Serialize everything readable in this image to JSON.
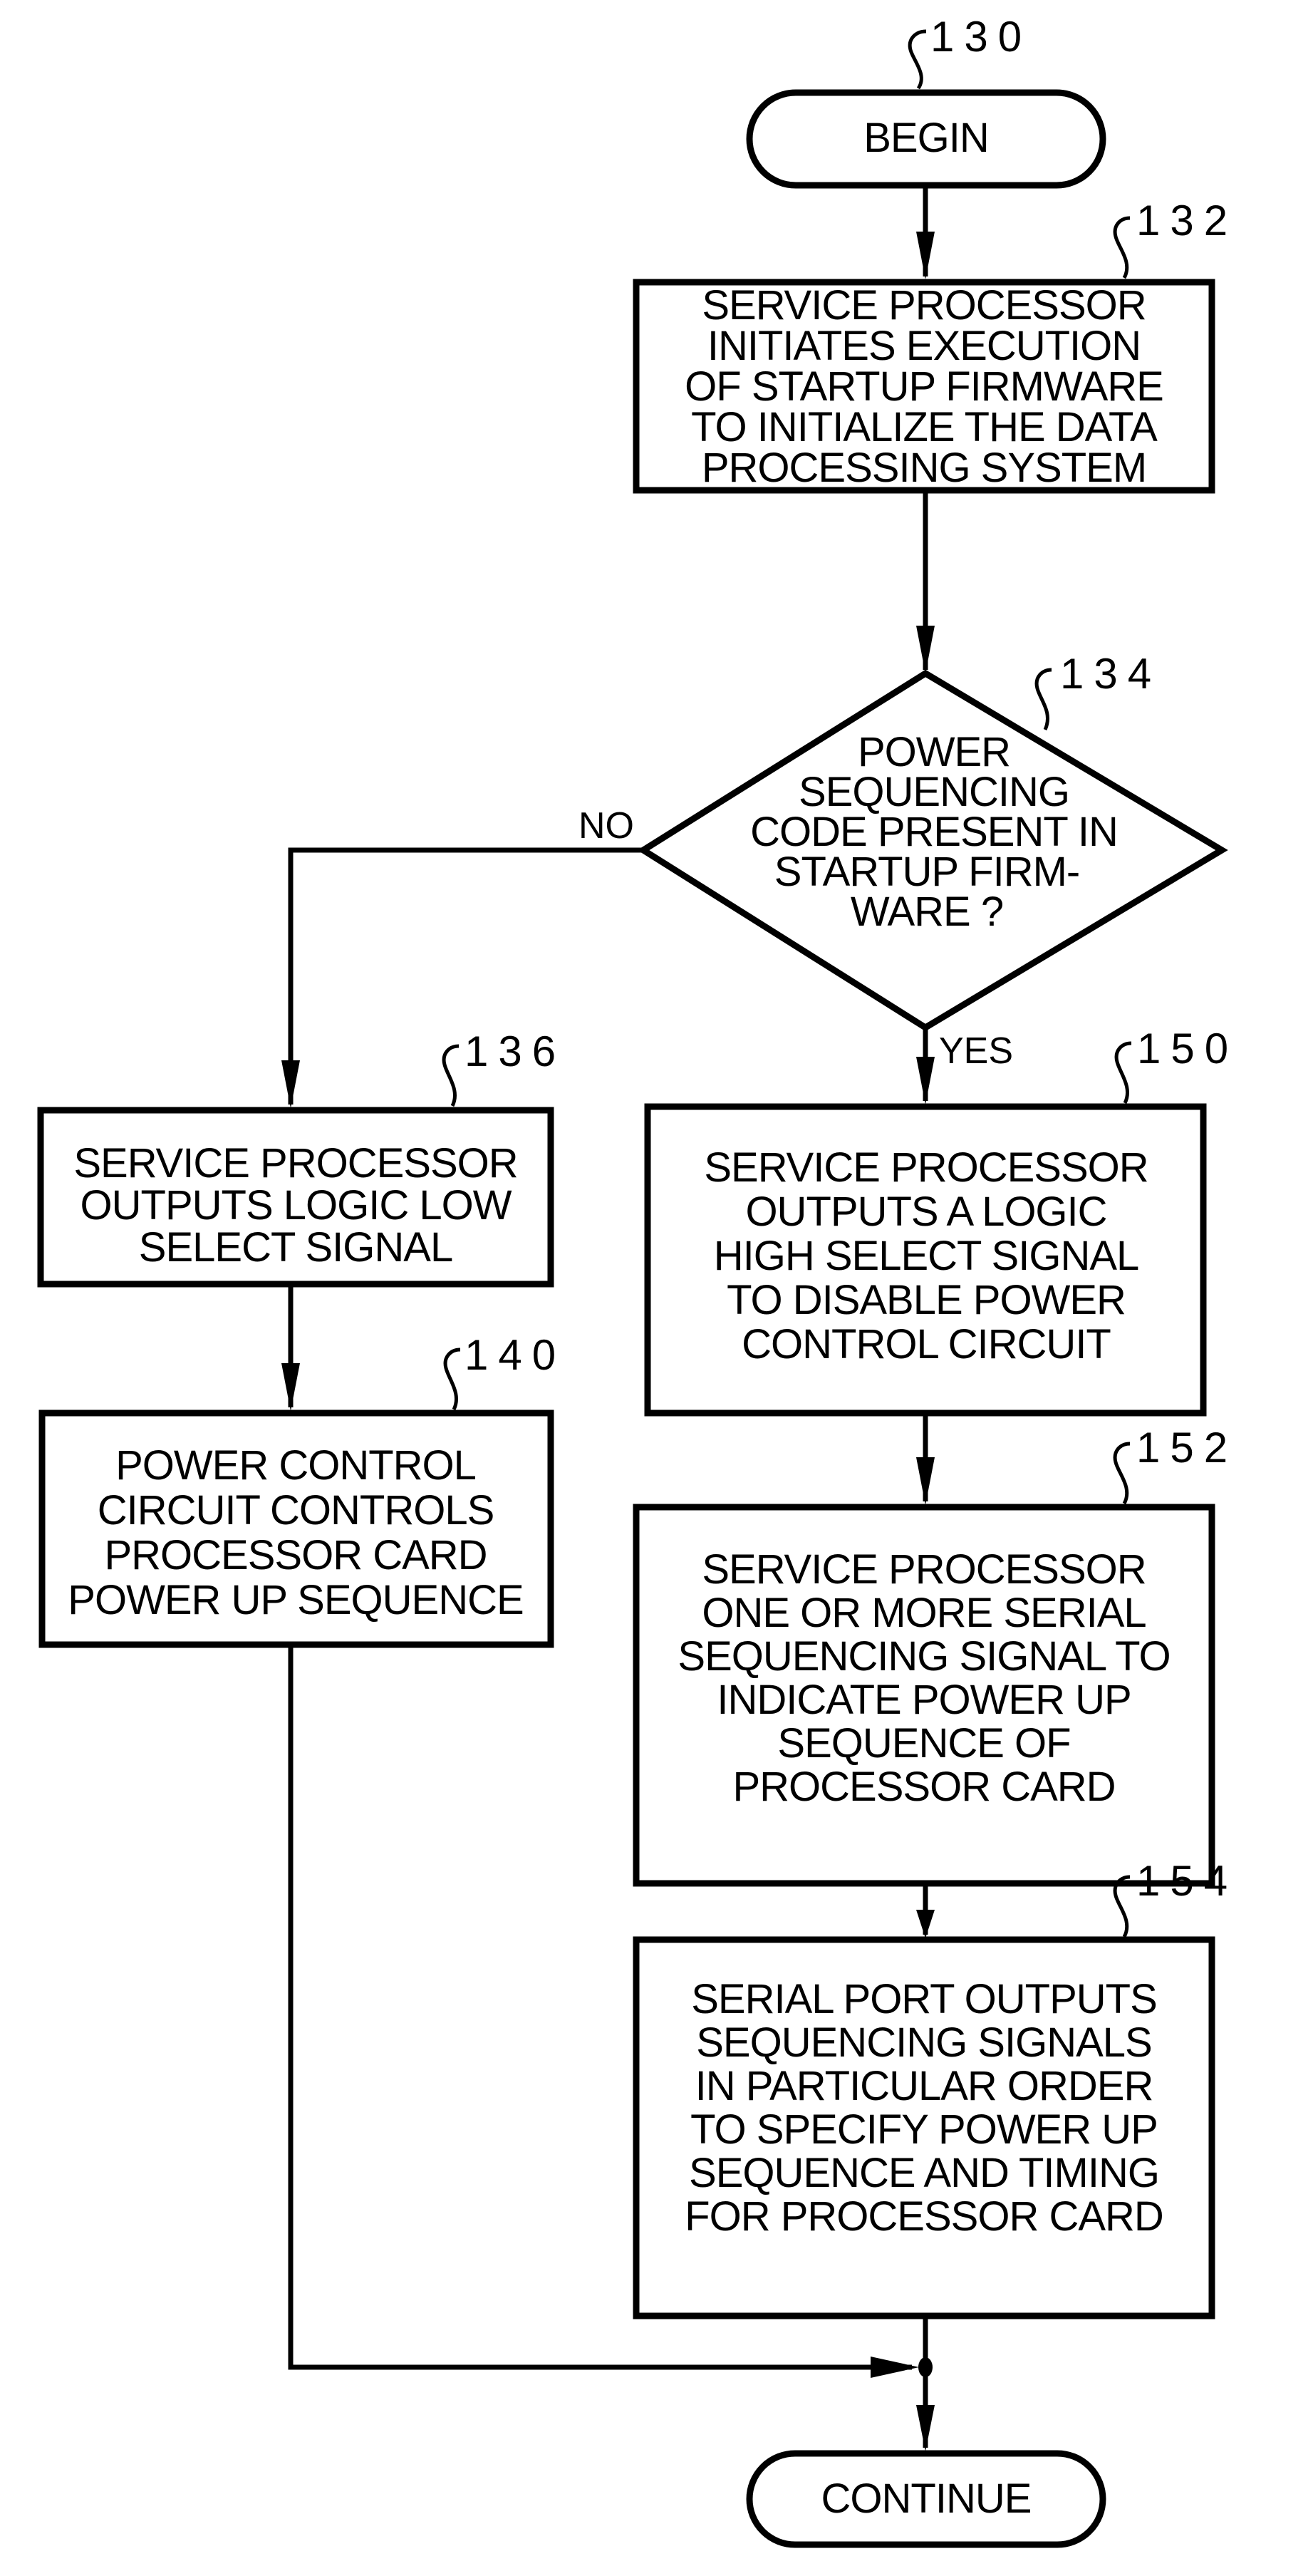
{
  "diagram": {
    "type": "flowchart",
    "nodes": [
      {
        "id": "130",
        "kind": "terminal",
        "ref": "130",
        "lines": [
          "BEGIN"
        ]
      },
      {
        "id": "132",
        "kind": "process",
        "ref": "132",
        "lines": [
          "SERVICE PROCESSOR",
          "INITIATES EXECUTION",
          "OF STARTUP FIRMWARE",
          "TO INITIALIZE THE DATA",
          "PROCESSING SYSTEM"
        ]
      },
      {
        "id": "134",
        "kind": "decision",
        "ref": "134",
        "lines": [
          "POWER",
          "SEQUENCING",
          "CODE PRESENT IN",
          "STARTUP FIRM-",
          "WARE ?"
        ]
      },
      {
        "id": "136",
        "kind": "process",
        "ref": "136",
        "lines": [
          "SERVICE PROCESSOR",
          "OUTPUTS LOGIC LOW",
          "SELECT SIGNAL"
        ]
      },
      {
        "id": "140",
        "kind": "process",
        "ref": "140",
        "lines": [
          "POWER CONTROL",
          "CIRCUIT CONTROLS",
          "PROCESSOR CARD",
          "POWER UP SEQUENCE"
        ]
      },
      {
        "id": "150",
        "kind": "process",
        "ref": "150",
        "lines": [
          "SERVICE PROCESSOR",
          "OUTPUTS A LOGIC",
          "HIGH SELECT SIGNAL",
          "TO DISABLE POWER",
          "CONTROL CIRCUIT"
        ]
      },
      {
        "id": "152",
        "kind": "process",
        "ref": "152",
        "lines": [
          "SERVICE PROCESSOR",
          "ONE OR MORE SERIAL",
          "SEQUENCING SIGNAL TO",
          "INDICATE POWER UP",
          "SEQUENCE OF",
          "PROCESSOR CARD"
        ]
      },
      {
        "id": "154",
        "kind": "process",
        "ref": "154",
        "lines": [
          "SERIAL PORT OUTPUTS",
          "SEQUENCING SIGNALS",
          "IN PARTICULAR ORDER",
          "TO SPECIFY POWER UP",
          "SEQUENCE AND TIMING",
          "FOR PROCESSOR CARD"
        ]
      },
      {
        "id": "continue",
        "kind": "terminal",
        "ref": "",
        "lines": [
          "CONTINUE"
        ]
      }
    ],
    "edges": [
      {
        "from": "130",
        "to": "132",
        "label": ""
      },
      {
        "from": "132",
        "to": "134",
        "label": ""
      },
      {
        "from": "134",
        "to": "136",
        "label": "NO"
      },
      {
        "from": "134",
        "to": "150",
        "label": "YES"
      },
      {
        "from": "136",
        "to": "140",
        "label": ""
      },
      {
        "from": "150",
        "to": "152",
        "label": ""
      },
      {
        "from": "152",
        "to": "154",
        "label": ""
      },
      {
        "from": "140",
        "to": "continue",
        "label": ""
      },
      {
        "from": "154",
        "to": "continue",
        "label": ""
      }
    ],
    "branch_labels": {
      "no": "NO",
      "yes": "YES"
    }
  }
}
